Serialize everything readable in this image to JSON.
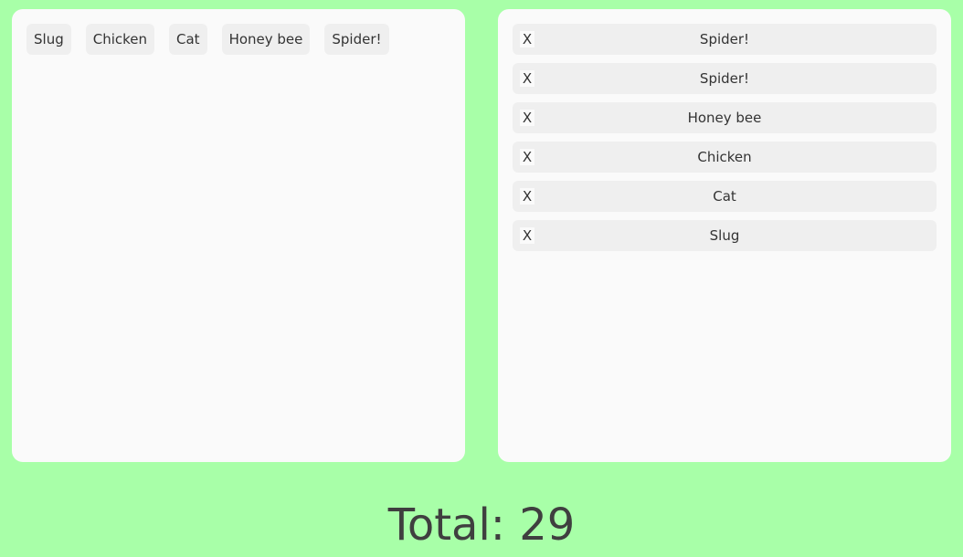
{
  "colors": {
    "background": "#a8ffa8",
    "panel": "#fafafa",
    "chip": "#efefef",
    "text": "#3a3a3a"
  },
  "palette": {
    "chips": [
      {
        "label": "Slug"
      },
      {
        "label": "Chicken"
      },
      {
        "label": "Cat"
      },
      {
        "label": "Honey bee"
      },
      {
        "label": "Spider!"
      }
    ]
  },
  "selected": {
    "remove_label": "X",
    "items": [
      {
        "label": "Spider!"
      },
      {
        "label": "Spider!"
      },
      {
        "label": "Honey bee"
      },
      {
        "label": "Chicken"
      },
      {
        "label": "Cat"
      },
      {
        "label": "Slug"
      }
    ]
  },
  "total": {
    "prefix": "Total:",
    "value": "29"
  }
}
